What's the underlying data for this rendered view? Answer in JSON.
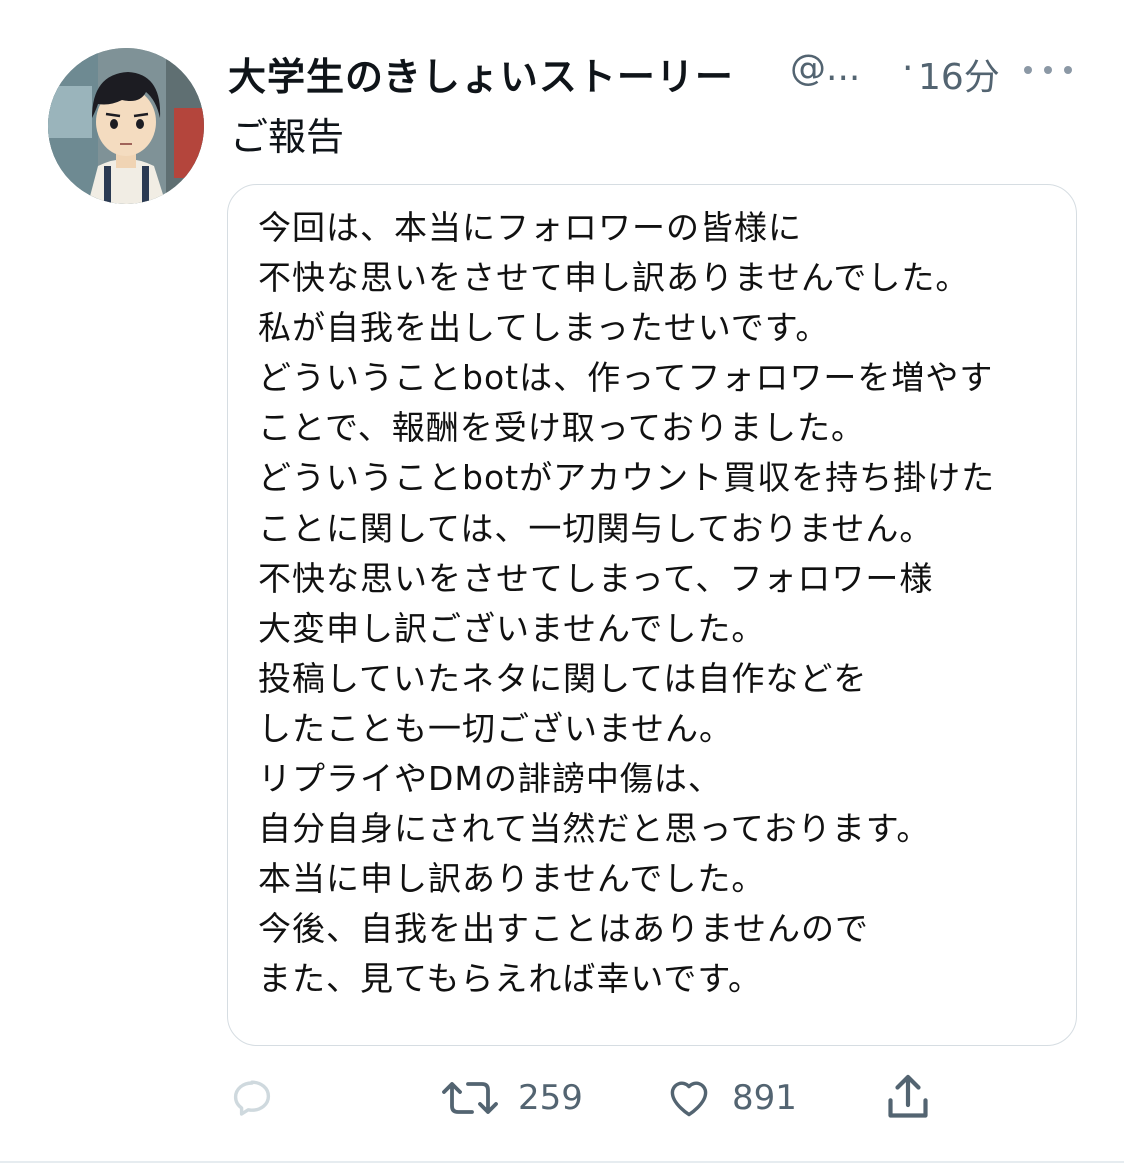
{
  "tweet": {
    "display_name": "大学生のきしょいストーリー",
    "handle": "@...",
    "separator": "·",
    "time": "16分",
    "text": "ご報告",
    "avatar_icon": "anime-boy-avatar",
    "more_icon": "more-options-icon"
  },
  "image_text": {
    "lines": [
      "今回は、本当にフォロワーの皆様に",
      "不快な思いをさせて申し訳ありませんでした。",
      "私が自我を出してしまったせいです。",
      "どういうことbotは、作ってフォロワーを増やす",
      "ことで、報酬を受け取っておりました。",
      "どういうことbotがアカウント買収を持ち掛けた",
      "ことに関しては、一切関与しておりません。",
      "不快な思いをさせてしまって、フォロワー様",
      "大変申し訳ございませんでした。",
      "投稿していたネタに関しては自作などを",
      "したことも一切ございません。",
      "リプライやDMの誹謗中傷は、",
      "自分自身にされて当然だと思っております。",
      "本当に申し訳ありませんでした。",
      "今後、自我を出すことはありませんので",
      "また、見てもらえれば幸いです。"
    ]
  },
  "actions": {
    "reply": {
      "icon": "reply-icon",
      "count": ""
    },
    "retweet": {
      "icon": "retweet-icon",
      "count": "259"
    },
    "like": {
      "icon": "heart-icon",
      "count": "891"
    },
    "share": {
      "icon": "share-icon"
    }
  },
  "colors": {
    "text_primary": "#0f1419",
    "text_secondary": "#536471",
    "border": "#d6dde2",
    "reply_icon": "#cfd9de"
  }
}
